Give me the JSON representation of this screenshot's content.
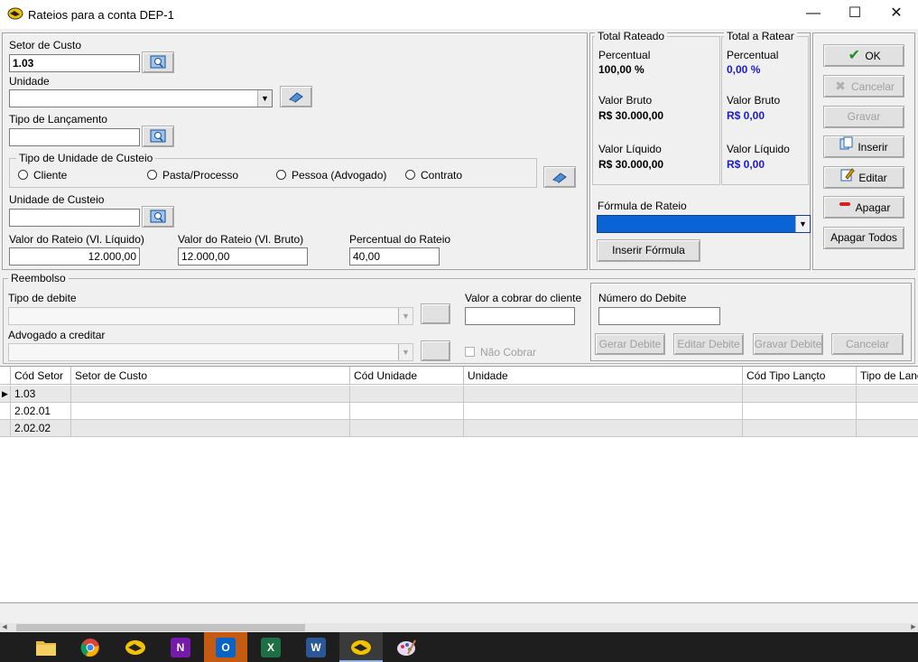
{
  "window": {
    "title": "Rateios para a conta DEP-1",
    "minimize_glyph": "—",
    "maximize_glyph": "☐",
    "close_glyph": "✕"
  },
  "form": {
    "setor_custo": {
      "label": "Setor de Custo",
      "value": "1.03"
    },
    "unidade": {
      "label": "Unidade",
      "value": ""
    },
    "tipo_lancamento": {
      "label": "Tipo de Lançamento",
      "value": ""
    },
    "tipo_unidade_custeio": {
      "label": "Tipo de Unidade de Custeio",
      "options": [
        "Cliente",
        "Pasta/Processo",
        "Pessoa (Advogado)",
        "Contrato"
      ]
    },
    "unidade_custeio": {
      "label": "Unidade de Custeio",
      "value": ""
    },
    "valor_liquido": {
      "label": "Valor do Rateio (Vl. Líquido)",
      "value": "12.000,00"
    },
    "valor_bruto": {
      "label": "Valor do Rateio (Vl. Bruto)",
      "value": "12.000,00"
    },
    "percentual": {
      "label": "Percentual do Rateio",
      "value": "40,00"
    }
  },
  "totals": {
    "rateado": {
      "title": "Total Rateado",
      "percentual_label": "Percentual",
      "percentual": "100,00 %",
      "bruto_label": "Valor Bruto",
      "bruto": "R$ 30.000,00",
      "liquido_label": "Valor Líquido",
      "liquido": "R$ 30.000,00"
    },
    "a_ratear": {
      "title": "Total a Ratear",
      "percentual_label": "Percentual",
      "percentual": "0,00 %",
      "bruto_label": "Valor Bruto",
      "bruto": "R$ 0,00",
      "liquido_label": "Valor Líquido",
      "liquido": "R$ 0,00"
    }
  },
  "formula": {
    "label": "Fórmula de Rateio",
    "value": "",
    "insert_button": "Inserir Fórmula"
  },
  "side_buttons": {
    "ok": "OK",
    "cancelar": "Cancelar",
    "gravar": "Gravar",
    "inserir": "Inserir",
    "editar": "Editar",
    "apagar": "Apagar",
    "apagar_todos": "Apagar Todos"
  },
  "reembolso": {
    "title": "Reembolso",
    "tipo_debite_label": "Tipo de debite",
    "advogado_label": "Advogado a creditar",
    "valor_cobrar_label": "Valor a cobrar do cliente",
    "nao_cobrar_label": "Não Cobrar",
    "numero_debite_label": "Número do Debite",
    "buttons": {
      "gerar": "Gerar Debite",
      "editar": "Editar Debite",
      "gravar": "Gravar Debite",
      "cancelar": "Cancelar"
    }
  },
  "grid": {
    "columns": [
      "Cód Setor",
      "Setor de Custo",
      "Cód Unidade",
      "Unidade",
      "Cód Tipo Lançto",
      "Tipo de Lança"
    ],
    "rows": [
      {
        "cod_setor": "1.03",
        "current": "▶"
      },
      {
        "cod_setor": "2.02.01"
      },
      {
        "cod_setor": "2.02.02"
      }
    ]
  },
  "taskbar": {
    "apps": [
      {
        "name": "file-explorer-icon",
        "color": "#e8b84a"
      },
      {
        "name": "chrome-icon",
        "color": "#4caf50"
      },
      {
        "name": "legal-app-icon",
        "color": "#f2c200"
      },
      {
        "name": "onenote-icon",
        "color": "#7719aa",
        "letter": "N"
      },
      {
        "name": "outlook-icon",
        "color": "#0a64c8",
        "letter": "O"
      },
      {
        "name": "excel-icon",
        "color": "#1d7044",
        "letter": "X"
      },
      {
        "name": "word-icon",
        "color": "#2b5797",
        "letter": "W"
      },
      {
        "name": "legal-app-active-icon",
        "color": "#f2c200"
      },
      {
        "name": "paint-icon",
        "color": "#b07bd0"
      }
    ]
  }
}
